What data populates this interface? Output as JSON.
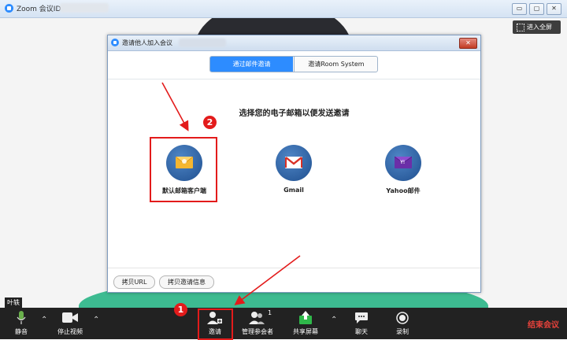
{
  "window": {
    "title": "Zoom 会议ID:",
    "controls": [
      "▭",
      "▢",
      "✕"
    ]
  },
  "video": {
    "fullscreen_label": "进入全屏",
    "participant_label": "叶轶"
  },
  "dialog": {
    "title": "邀请他人加入会议",
    "close_label": "✕",
    "tabs": [
      {
        "label": "通过邮件邀请",
        "active": true
      },
      {
        "label": "邀请Room System",
        "active": false
      }
    ],
    "prompt": "选择您的电子邮箱以便发送邀请",
    "options": [
      {
        "label": "默认邮箱客户端",
        "icon": "default-mail-icon"
      },
      {
        "label": "Gmail",
        "icon": "gmail-icon"
      },
      {
        "label": "Yahoo邮件",
        "icon": "yahoo-mail-icon"
      }
    ],
    "buttons": {
      "copy_url": "拷贝URL",
      "copy_invite": "拷贝邀请信息"
    }
  },
  "toolbar": {
    "mute": "静音",
    "stop_video": "停止视频",
    "invite": "邀请",
    "manage_participants": "管理参会者",
    "participant_count": "1",
    "share_screen": "共享屏幕",
    "chat": "聊天",
    "record": "录制",
    "end_meeting": "结束会议"
  },
  "annotations": {
    "badge_1": "1",
    "badge_2": "2"
  },
  "colors": {
    "accent": "#2d8cff",
    "toolbar_bg": "#222222",
    "end_meeting": "#e8423b",
    "annotation_red": "#e31b1b",
    "share_green": "#2fb84a"
  }
}
